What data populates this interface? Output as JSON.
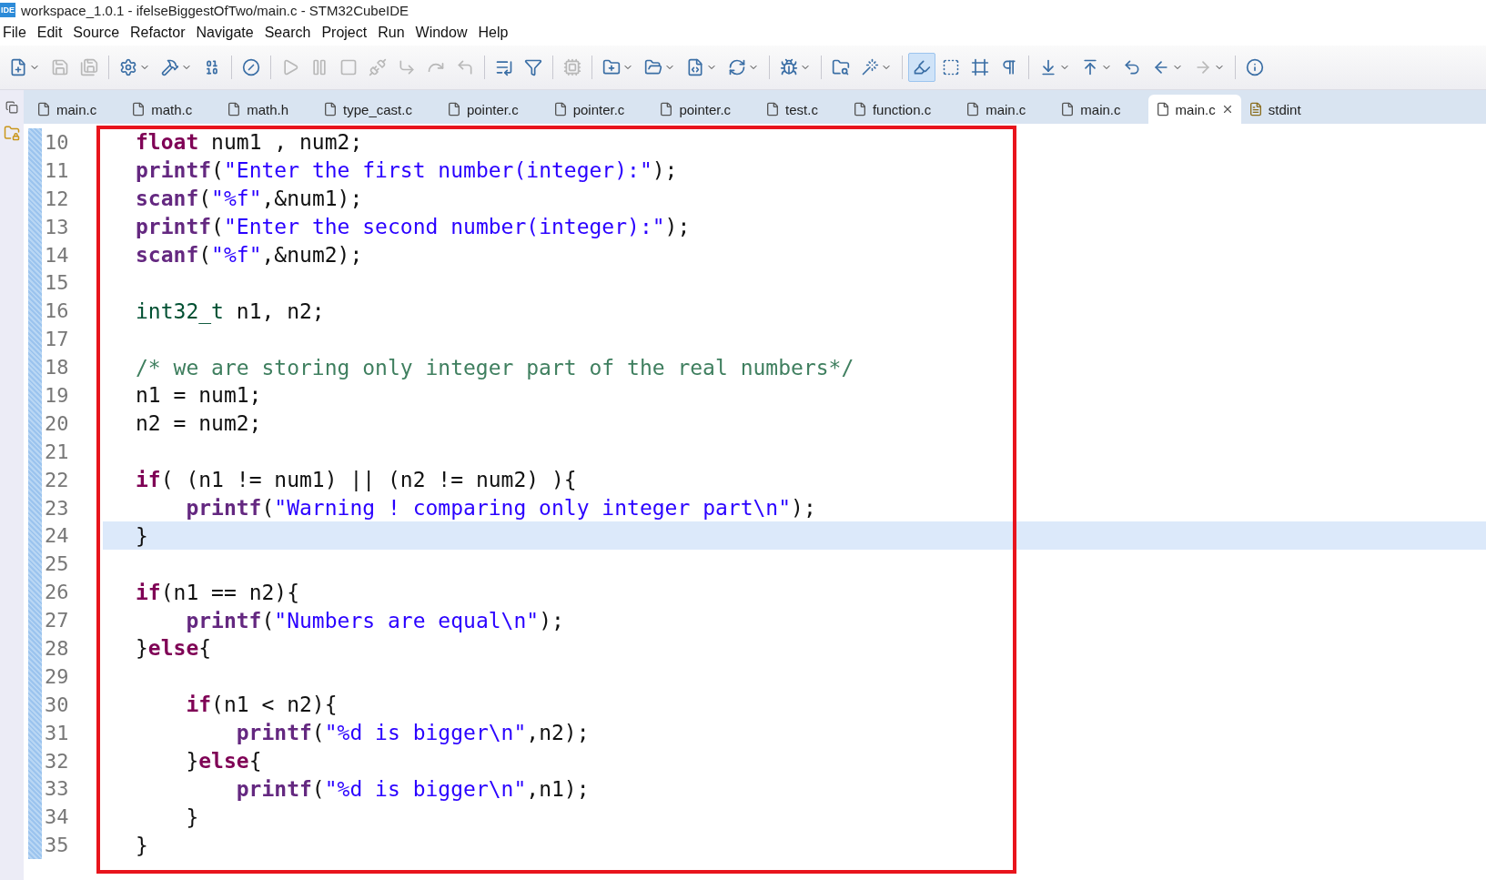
{
  "window": {
    "icon_text": "IDE",
    "title": "workspace_1.0.1 - ifelseBiggestOfTwo/main.c - STM32CubeIDE"
  },
  "menu": [
    "File",
    "Edit",
    "Source",
    "Refactor",
    "Navigate",
    "Search",
    "Project",
    "Run",
    "Window",
    "Help"
  ],
  "toolbar": [
    {
      "kind": "new",
      "on": false,
      "disabled": false,
      "menu": true
    },
    {
      "kind": "save",
      "on": false,
      "disabled": true,
      "menu": false
    },
    {
      "kind": "save-all",
      "on": false,
      "disabled": true,
      "menu": false
    },
    {
      "kind": "separator"
    },
    {
      "kind": "configure",
      "on": false,
      "disabled": false,
      "menu": true
    },
    {
      "kind": "build",
      "on": false,
      "disabled": false,
      "menu": true
    },
    {
      "kind": "binary",
      "on": false,
      "disabled": false,
      "menu": false
    },
    {
      "kind": "separator"
    },
    {
      "kind": "skip",
      "on": false,
      "disabled": false,
      "menu": false
    },
    {
      "kind": "separator"
    },
    {
      "kind": "resume",
      "on": false,
      "disabled": true,
      "menu": false
    },
    {
      "kind": "suspend",
      "on": false,
      "disabled": true,
      "menu": false
    },
    {
      "kind": "terminate",
      "on": false,
      "disabled": true,
      "menu": false
    },
    {
      "kind": "disconnect",
      "on": false,
      "disabled": true,
      "menu": false
    },
    {
      "kind": "step-into",
      "on": false,
      "disabled": true,
      "menu": false
    },
    {
      "kind": "step-over",
      "on": false,
      "disabled": true,
      "menu": false
    },
    {
      "kind": "step-return",
      "on": false,
      "disabled": true,
      "menu": false
    },
    {
      "kind": "separator"
    },
    {
      "kind": "instruction",
      "on": false,
      "disabled": false,
      "menu": false
    },
    {
      "kind": "filter",
      "on": false,
      "disabled": false,
      "menu": false
    },
    {
      "kind": "separator"
    },
    {
      "kind": "device",
      "on": false,
      "disabled": true,
      "menu": false
    },
    {
      "kind": "separator"
    },
    {
      "kind": "new-project",
      "on": false,
      "disabled": false,
      "menu": true
    },
    {
      "kind": "new-folder",
      "on": false,
      "disabled": false,
      "menu": true
    },
    {
      "kind": "new-file",
      "on": false,
      "disabled": false,
      "menu": true
    },
    {
      "kind": "refresh",
      "on": false,
      "disabled": false,
      "menu": true
    },
    {
      "kind": "separator"
    },
    {
      "kind": "debug",
      "on": false,
      "disabled": false,
      "menu": true
    },
    {
      "kind": "separator"
    },
    {
      "kind": "open",
      "on": false,
      "disabled": false,
      "menu": false
    },
    {
      "kind": "wand",
      "on": false,
      "disabled": false,
      "menu": true
    },
    {
      "kind": "separator"
    },
    {
      "kind": "highlight",
      "on": true,
      "disabled": false,
      "menu": false
    },
    {
      "kind": "block",
      "on": false,
      "disabled": false,
      "menu": false
    },
    {
      "kind": "frame",
      "on": false,
      "disabled": false,
      "menu": false
    },
    {
      "kind": "whitespace",
      "on": false,
      "disabled": false,
      "menu": false
    },
    {
      "kind": "separator"
    },
    {
      "kind": "next",
      "on": false,
      "disabled": false,
      "menu": true
    },
    {
      "kind": "previous",
      "on": false,
      "disabled": false,
      "menu": true
    },
    {
      "kind": "last-edit",
      "on": false,
      "disabled": false,
      "menu": false
    },
    {
      "kind": "back",
      "on": false,
      "disabled": false,
      "menu": true
    },
    {
      "kind": "forward",
      "on": false,
      "disabled": true,
      "menu": true
    },
    {
      "kind": "separator"
    },
    {
      "kind": "info",
      "on": false,
      "disabled": false,
      "menu": false
    }
  ],
  "tabs": [
    {
      "label": "main.c",
      "kind": "c",
      "selected": false
    },
    {
      "label": "math.c",
      "kind": "c",
      "selected": false
    },
    {
      "label": "math.h",
      "kind": "c",
      "selected": false
    },
    {
      "label": "type_cast.c",
      "kind": "c",
      "selected": false
    },
    {
      "label": "pointer.c",
      "kind": "c",
      "selected": false
    },
    {
      "label": "pointer.c",
      "kind": "c",
      "selected": false
    },
    {
      "label": "pointer.c",
      "kind": "c",
      "selected": false
    },
    {
      "label": "test.c",
      "kind": "c",
      "selected": false
    },
    {
      "label": "function.c",
      "kind": "c",
      "selected": false
    },
    {
      "label": "main.c",
      "kind": "c",
      "selected": false
    },
    {
      "label": "main.c",
      "kind": "c",
      "selected": false
    },
    {
      "label": "main.c",
      "kind": "c",
      "selected": true
    },
    {
      "label": "stdint",
      "kind": "h",
      "selected": false
    }
  ],
  "editor": {
    "lines": [
      {
        "number": "10",
        "current": false,
        "tokens": [
          {
            "kind": "keyword",
            "text": "float"
          },
          {
            "kind": "plain",
            "text": " num1 , num2;"
          }
        ]
      },
      {
        "number": "11",
        "current": false,
        "tokens": [
          {
            "kind": "function",
            "text": "printf"
          },
          {
            "kind": "plain",
            "text": "("
          },
          {
            "kind": "string",
            "text": "\"Enter the first number(integer):\""
          },
          {
            "kind": "plain",
            "text": ");"
          }
        ]
      },
      {
        "number": "12",
        "current": false,
        "tokens": [
          {
            "kind": "function",
            "text": "scanf"
          },
          {
            "kind": "plain",
            "text": "("
          },
          {
            "kind": "string",
            "text": "\"%f\""
          },
          {
            "kind": "plain",
            "text": ",&num1);"
          }
        ]
      },
      {
        "number": "13",
        "current": false,
        "tokens": [
          {
            "kind": "function",
            "text": "printf"
          },
          {
            "kind": "plain",
            "text": "("
          },
          {
            "kind": "string",
            "text": "\"Enter the second number(integer):\""
          },
          {
            "kind": "plain",
            "text": ");"
          }
        ]
      },
      {
        "number": "14",
        "current": false,
        "tokens": [
          {
            "kind": "function",
            "text": "scanf"
          },
          {
            "kind": "plain",
            "text": "("
          },
          {
            "kind": "string",
            "text": "\"%f\""
          },
          {
            "kind": "plain",
            "text": ",&num2);"
          }
        ]
      },
      {
        "number": "15",
        "current": false
      },
      {
        "number": "16",
        "current": false,
        "tokens": [
          {
            "kind": "type",
            "text": "int32_t"
          },
          {
            "kind": "plain",
            "text": " n1, n2;"
          }
        ]
      },
      {
        "number": "17",
        "current": false
      },
      {
        "number": "18",
        "current": false,
        "tokens": [
          {
            "kind": "comment",
            "text": "/* we are storing only integer part of the real numbers*/"
          }
        ]
      },
      {
        "number": "19",
        "current": false,
        "tokens": [
          {
            "kind": "plain",
            "text": "n1 = num1;"
          }
        ]
      },
      {
        "number": "20",
        "current": false,
        "tokens": [
          {
            "kind": "plain",
            "text": "n2 = num2;"
          }
        ]
      },
      {
        "number": "21",
        "current": false
      },
      {
        "number": "22",
        "current": false,
        "tokens": [
          {
            "kind": "keyword",
            "text": "if"
          },
          {
            "kind": "plain",
            "text": "( (n1 != num1) || (n2 != num2) ){"
          }
        ],
        "children": [
          {
            "number": "23",
            "current": false,
            "tokens": [
              {
                "kind": "function",
                "text": "printf"
              },
              {
                "kind": "plain",
                "text": "("
              },
              {
                "kind": "string",
                "text": "\"Warning ! comparing only integer part\\n\""
              },
              {
                "kind": "plain",
                "text": ");"
              }
            ]
          }
        ]
      },
      {
        "number": "24",
        "current": true,
        "tokens": [
          {
            "kind": "plain",
            "text": "}"
          }
        ]
      },
      {
        "number": "25",
        "current": false
      },
      {
        "number": "26",
        "current": false,
        "tokens": [
          {
            "kind": "keyword",
            "text": "if"
          },
          {
            "kind": "plain",
            "text": "(n1 == n2){"
          }
        ],
        "children": [
          {
            "number": "27",
            "current": false,
            "tokens": [
              {
                "kind": "function",
                "text": "printf"
              },
              {
                "kind": "plain",
                "text": "("
              },
              {
                "kind": "string",
                "text": "\"Numbers are equal\\n\""
              },
              {
                "kind": "plain",
                "text": ");"
              }
            ]
          }
        ]
      },
      {
        "number": "28",
        "current": false,
        "tokens": [
          {
            "kind": "plain",
            "text": "}"
          },
          {
            "kind": "keyword",
            "text": "else"
          },
          {
            "kind": "plain",
            "text": "{"
          }
        ],
        "children": [
          {
            "number": "29",
            "current": false
          },
          {
            "number": "30",
            "current": false,
            "tokens": [
              {
                "kind": "keyword",
                "text": "if"
              },
              {
                "kind": "plain",
                "text": "(n1 < n2){"
              }
            ],
            "children": [
              {
                "number": "31",
                "current": false,
                "tokens": [
                  {
                    "kind": "function",
                    "text": "printf"
                  },
                  {
                    "kind": "plain",
                    "text": "("
                  },
                  {
                    "kind": "string",
                    "text": "\"%d is bigger\\n\""
                  },
                  {
                    "kind": "plain",
                    "text": ",n2);"
                  }
                ]
              }
            ]
          },
          {
            "number": "32",
            "current": false,
            "tokens": [
              {
                "kind": "plain",
                "text": "}"
              },
              {
                "kind": "keyword",
                "text": "else"
              },
              {
                "kind": "plain",
                "text": "{"
              }
            ],
            "children": [
              {
                "number": "33",
                "current": false,
                "tokens": [
                  {
                    "kind": "function",
                    "text": "printf"
                  },
                  {
                    "kind": "plain",
                    "text": "("
                  },
                  {
                    "kind": "string",
                    "text": "\"%d is bigger\\n\""
                  },
                  {
                    "kind": "plain",
                    "text": ",n1);"
                  }
                ]
              }
            ]
          },
          {
            "number": "34",
            "current": false,
            "tokens": [
              {
                "kind": "plain",
                "text": "}"
              }
            ]
          }
        ]
      },
      {
        "number": "35",
        "current": false,
        "tokens": [
          {
            "kind": "plain",
            "text": "}"
          }
        ]
      }
    ]
  }
}
